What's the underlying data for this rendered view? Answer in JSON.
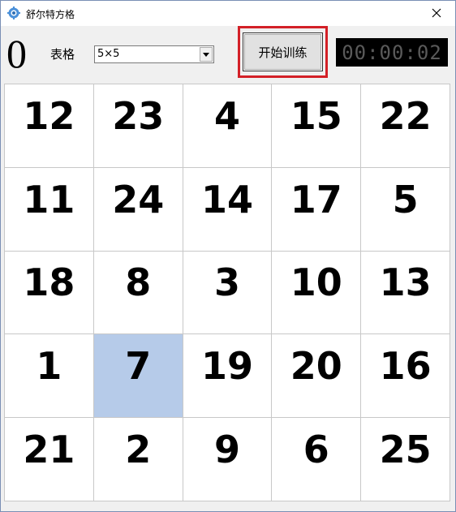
{
  "window": {
    "title": "舒尔特方格",
    "close_symbol": "✕"
  },
  "toolbar": {
    "score": "0",
    "table_label": "表格",
    "size_select": {
      "value": "5×5"
    },
    "start_button_label": "开始训练",
    "timer": "00:00:02"
  },
  "grid": {
    "rows": 5,
    "cols": 5,
    "cells": [
      [
        "12",
        "23",
        "4",
        "15",
        "22"
      ],
      [
        "11",
        "24",
        "14",
        "17",
        "5"
      ],
      [
        "18",
        "8",
        "3",
        "10",
        "13"
      ],
      [
        "1",
        "7",
        "19",
        "20",
        "16"
      ],
      [
        "21",
        "2",
        "9",
        "6",
        "25"
      ]
    ],
    "selected": {
      "row": 3,
      "col": 1
    },
    "selected_color": "#b6cbe9"
  },
  "colors": {
    "highlight_border": "#d32027",
    "timer_bg": "#000000",
    "timer_fg": "#5a5a5a"
  }
}
